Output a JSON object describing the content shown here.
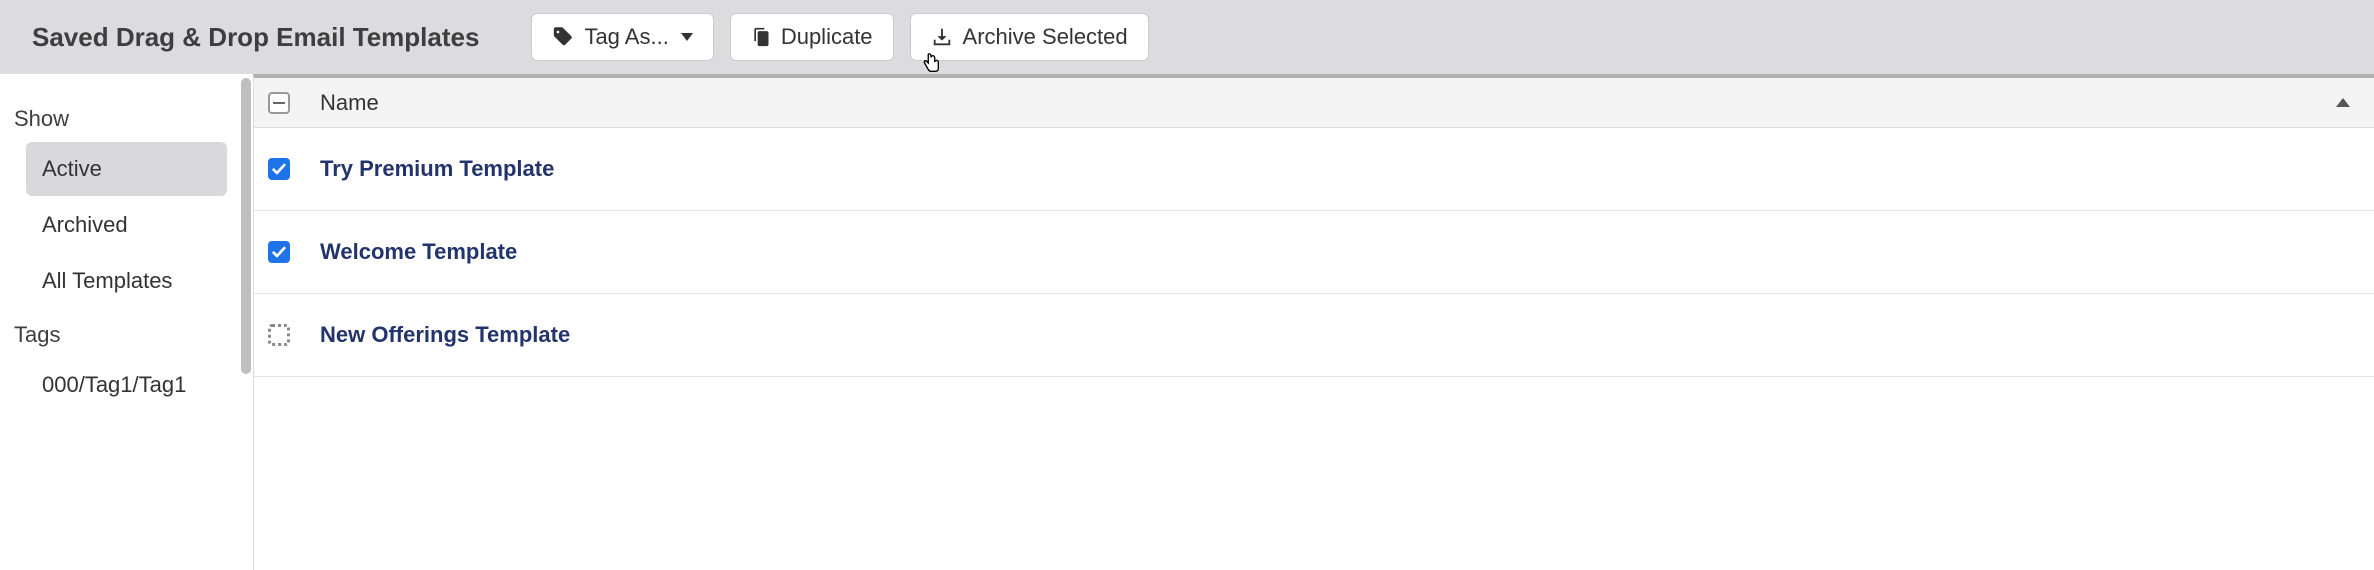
{
  "header": {
    "title": "Saved Drag & Drop Email Templates",
    "buttons": {
      "tag_as": "Tag As...",
      "duplicate": "Duplicate",
      "archive": "Archive Selected"
    }
  },
  "sidebar": {
    "show_heading": "Show",
    "show_items": [
      {
        "label": "Active",
        "active": true
      },
      {
        "label": "Archived",
        "active": false
      },
      {
        "label": "All Templates",
        "active": false
      }
    ],
    "tags_heading": "Tags",
    "tags_items": [
      {
        "label": "000/Tag1/Tag1"
      }
    ]
  },
  "table": {
    "columns": {
      "name": "Name"
    },
    "rows": [
      {
        "name": "Try Premium Template",
        "checked": true
      },
      {
        "name": "Welcome Template",
        "checked": true
      },
      {
        "name": "New Offerings Template",
        "checked": false
      }
    ]
  }
}
